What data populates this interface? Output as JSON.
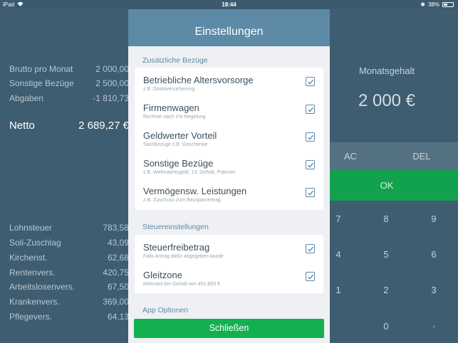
{
  "status": {
    "device": "iPad",
    "time": "18:44",
    "battery": "38%"
  },
  "left_panel": {
    "top_rows": [
      {
        "label": "Brutto pro Monat",
        "value": "2 000,00"
      },
      {
        "label": "Sonstige Bezüge",
        "value": "2 500,00"
      },
      {
        "label": "Abgaben",
        "value": "-1 810,73"
      }
    ],
    "netto": {
      "label": "Netto",
      "value": "2 689,27 €"
    },
    "bottom_rows": [
      {
        "label": "Lohnsteuer",
        "value": "783,58"
      },
      {
        "label": "Soli-Zuschlag",
        "value": "43,09"
      },
      {
        "label": "Kirchenst.",
        "value": "62,68"
      },
      {
        "label": "Rentenvers.",
        "value": "420,75"
      },
      {
        "label": "Arbeitslosenvers.",
        "value": "67,50"
      },
      {
        "label": "Krankenvers.",
        "value": "369,00"
      },
      {
        "label": "Pflegevers.",
        "value": "64,13"
      }
    ]
  },
  "right_panel": {
    "label": "Monatsgehalt",
    "value": "2 000 €",
    "ac": "AC",
    "del": "DEL",
    "ok": "OK",
    "keys": [
      "7",
      "8",
      "9",
      "4",
      "5",
      "6",
      "1",
      "2",
      "3",
      "0",
      ","
    ]
  },
  "modal": {
    "title": "Einstellungen",
    "sections": [
      {
        "title": "Zusätzliche Bezüge",
        "items": [
          {
            "label": "Betriebliche Altersvorsorge",
            "sub": "z.B. Direktversicherung",
            "checked": true
          },
          {
            "label": "Firmenwagen",
            "sub": "Rechner nach 1% Regelung",
            "checked": true
          },
          {
            "label": "Geldwerter Vorteil",
            "sub": "Sachbezüge z.B. Geschenke",
            "checked": true
          },
          {
            "label": "Sonstige Bezüge",
            "sub": "z.B. Weihnachtsgeld, 13. Gehalt, Prämien",
            "checked": true
          },
          {
            "label": "Vermögensw. Leistungen",
            "sub": "z.B. Zuschuss zum Bausparvertrag",
            "checked": true
          }
        ]
      },
      {
        "title": "Steuereinstellungen",
        "items": [
          {
            "label": "Steuerfreibetrag",
            "sub": "Falls Antrag dafür abgegeben wurde",
            "checked": true
          },
          {
            "label": "Gleitzone",
            "sub": "Relevant bei Gehalt von 451-850 €",
            "checked": true
          }
        ]
      },
      {
        "title": "App Optionen",
        "items": []
      }
    ],
    "close_label": "Schließen"
  }
}
